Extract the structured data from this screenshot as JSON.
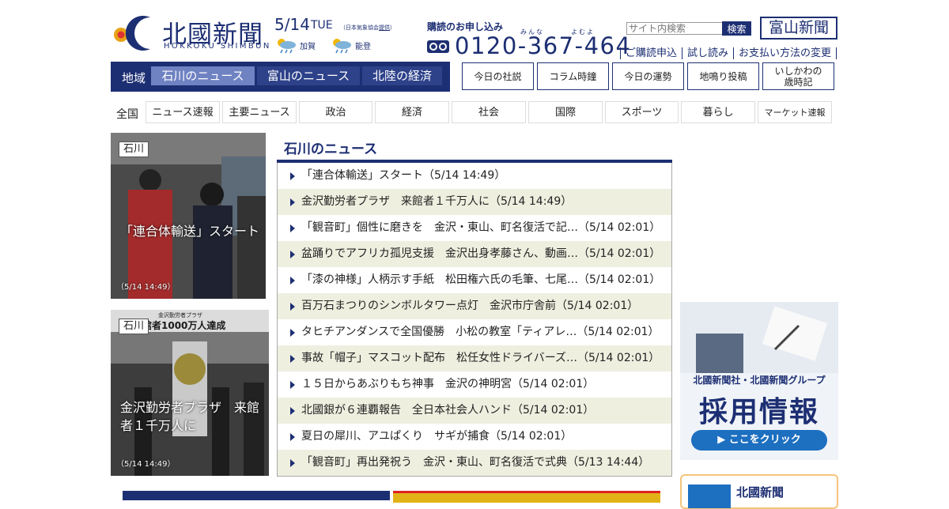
{
  "logo": {
    "jp": "北國新聞",
    "en": "HOKKOKU SHIMBUN"
  },
  "date": {
    "day": "5/14",
    "weekday": "TUE",
    "weather_source": "（日本気象協会",
    "weather_source_link": "提供",
    "weather_source_end": "）"
  },
  "weather": [
    {
      "area": "加賀",
      "icon": "sun-rain-icon"
    },
    {
      "area": "能登",
      "icon": "sun-rain-icon"
    }
  ],
  "subscription": {
    "title": "購読のお申し込み",
    "ruby1": "みんな",
    "ruby2": "よむよ",
    "phone": "0120-367-464",
    "icon": "free-dial-icon"
  },
  "search": {
    "placeholder": "サイト内検索",
    "button": "検索"
  },
  "toyama_logo": "富山新聞",
  "sub_links": [
    "ご購読申込",
    "試し読み",
    "お支払い方法の変更"
  ],
  "region_nav": {
    "label": "地域",
    "tabs": [
      {
        "label": "石川のニュース",
        "active": true
      },
      {
        "label": "富山のニュース",
        "active": false
      },
      {
        "label": "北陸の経済",
        "active": false
      }
    ]
  },
  "column_links": [
    "今日の社説",
    "コラム時鐘",
    "今日の運勢",
    "地鳴り投稿",
    "いしかわの|歳時記"
  ],
  "categories": {
    "label": "全国",
    "items": [
      "ニュース速報",
      "主要ニュース",
      "政治",
      "経済",
      "社会",
      "国際",
      "スポーツ",
      "暮らし",
      "マーケット速報"
    ]
  },
  "photos": [
    {
      "tag": "石川",
      "caption": "「連合体輸送」スタート",
      "time": "（5/14 14:49）"
    },
    {
      "tag": "石川",
      "caption": "金沢勤労者プラザ　来館者１千万人に",
      "time": "（5/14 14:49）",
      "sign": "金沢勤労者プラザ",
      "sign2": "館者1000万人達成"
    }
  ],
  "news": {
    "title": "石川のニュース",
    "items": [
      "「連合体輸送」スタート（5/14 14:49）",
      "金沢勤労者プラザ　来館者１千万人に（5/14 14:49）",
      "「観音町」個性に磨きを　金沢・東山、町名復活で記…（5/14 02:01）",
      "盆踊りでアフリカ孤児支援　金沢出身孝藤さん、動画…（5/14 02:01）",
      "「漆の神様」人柄示す手紙　松田権六氏の毛筆、七尾…（5/14 02:01）",
      "百万石まつりのシンボルタワー点灯　金沢市庁舎前（5/14 02:01）",
      "タヒチアンダンスで全国優勝　小松の教室「ティアレ…（5/14 02:01）",
      "事故「帽子」マスコット配布　松任女性ドライバーズ…（5/14 02:01）",
      "１５日からあぶりもち神事　金沢の神明宮（5/14 02:01）",
      "北國銀が６連覇報告　全日本社会人ハンド（5/14 02:01）",
      "夏日の犀川、アユぱくり　サギが捕食（5/14 02:01）",
      "「観音町」再出発祝う　金沢・東山、町名復活で式典（5/13 14:44）"
    ]
  },
  "banner": {
    "sub": "北國新聞社・北國新聞グループ",
    "main": "採用情報",
    "button": "▶ ここをクリック"
  },
  "card": {
    "title": "北國新聞"
  },
  "colors": {
    "brand": "#1d2f73",
    "active_tab": "#6f82c2",
    "alt_row": "#efefe0"
  }
}
